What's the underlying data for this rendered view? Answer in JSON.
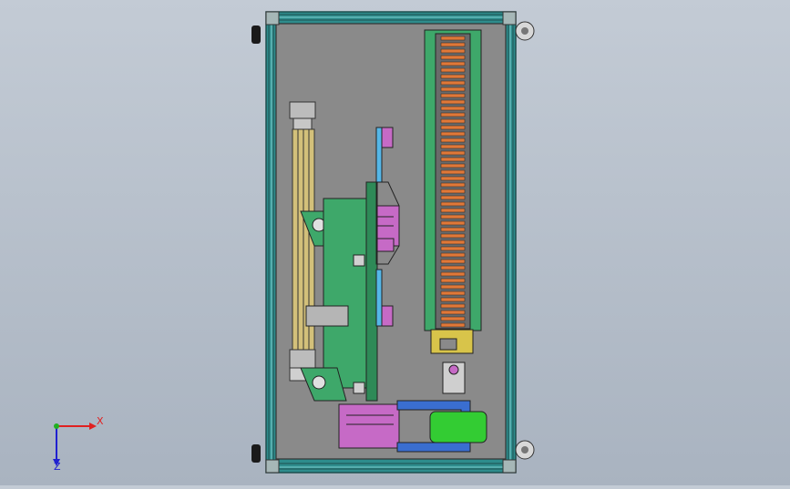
{
  "viewport": {
    "background_top": "#c3cbd5",
    "background_bottom": "#a9b3c0"
  },
  "colors": {
    "frame_teal": "#2e8c8c",
    "plate_gray": "#8a8a8a",
    "green_block": "#3ea86a",
    "magenta_block": "#c66ac6",
    "orange_coil": "#e07838",
    "cylinder_green": "#33cc33",
    "blue_bar": "#55b7e8"
  },
  "triad": {
    "x_label": "X",
    "z_label": "Z",
    "x_color": "#e02020",
    "y_color": "#20b020",
    "z_color": "#2020d0"
  }
}
